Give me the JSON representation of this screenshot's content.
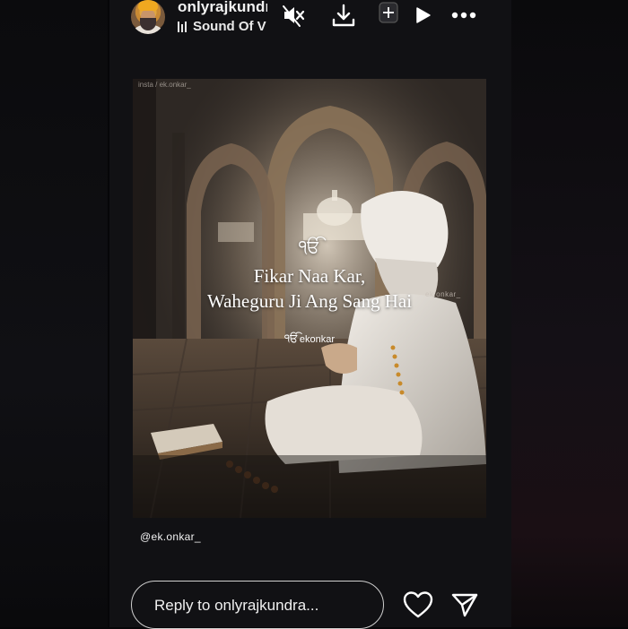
{
  "header": {
    "username": "onlyrajkundr",
    "music_label": "Sound Of V",
    "icons": [
      "mute-icon",
      "download-icon",
      "add-story-icon",
      "play-icon",
      "more-icon"
    ]
  },
  "story": {
    "symbol": "ੴ",
    "quote_line1": "Fikar Naa Kar,",
    "quote_line2": "Waheguru Ji Ang Sang Hai",
    "brand_symbol": "ੴ",
    "brand_name": "ekonkar",
    "watermark_top": "insta / ek.onkar_",
    "watermark_side": "ek.onkar_",
    "handle": "@ek.onkar_"
  },
  "footer": {
    "reply_placeholder": "Reply to onlyrajkundra...",
    "icons": [
      "heart-icon",
      "send-icon"
    ]
  },
  "colors": {
    "background": "#060608",
    "text": "#ffffff",
    "reply_border": "#cfcfcf"
  }
}
